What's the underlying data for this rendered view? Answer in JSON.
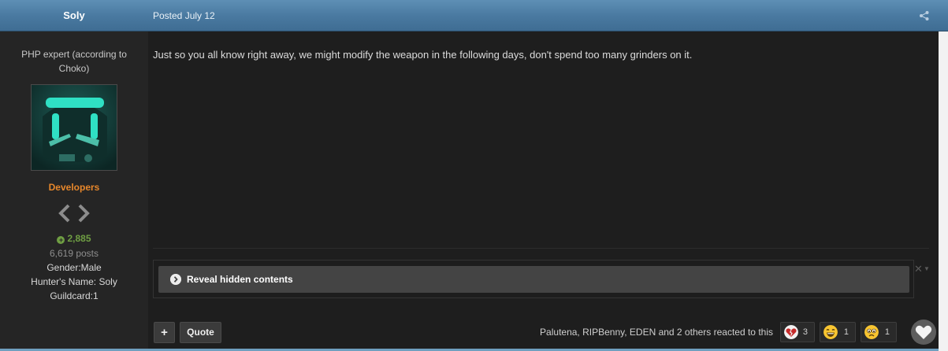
{
  "header": {
    "author": "Soly",
    "posted": "Posted July 12"
  },
  "sidebar": {
    "member_title": "PHP expert (according to Choko)",
    "group": "Developers",
    "reputation": "2,885",
    "posts": "6,619 posts",
    "fields": {
      "gender": "Gender:Male",
      "hunter_name": "Hunter's Name: Soly",
      "guildcard": "Guildcard:1"
    }
  },
  "post": {
    "body": "Just so you all know right away, we might modify the weapon in the following days, don't spend too many grinders on it."
  },
  "spoiler": {
    "label": "Reveal hidden contents"
  },
  "actions": {
    "plus_label": "+",
    "quote_label": "Quote"
  },
  "reactions": {
    "summary": "Palutena, RIPBenny, EDEN and 2 others reacted to this",
    "items": [
      {
        "icon": "broken-heart-icon",
        "count": "3"
      },
      {
        "icon": "laughing-face-icon",
        "count": "1"
      },
      {
        "icon": "sad-face-icon",
        "count": "1"
      }
    ]
  },
  "colors": {
    "header_blue": "#4a7aa1",
    "group_orange": "#e7872b",
    "reputation_green": "#6f9e43",
    "avatar_cyan": "#2fe0c4"
  }
}
